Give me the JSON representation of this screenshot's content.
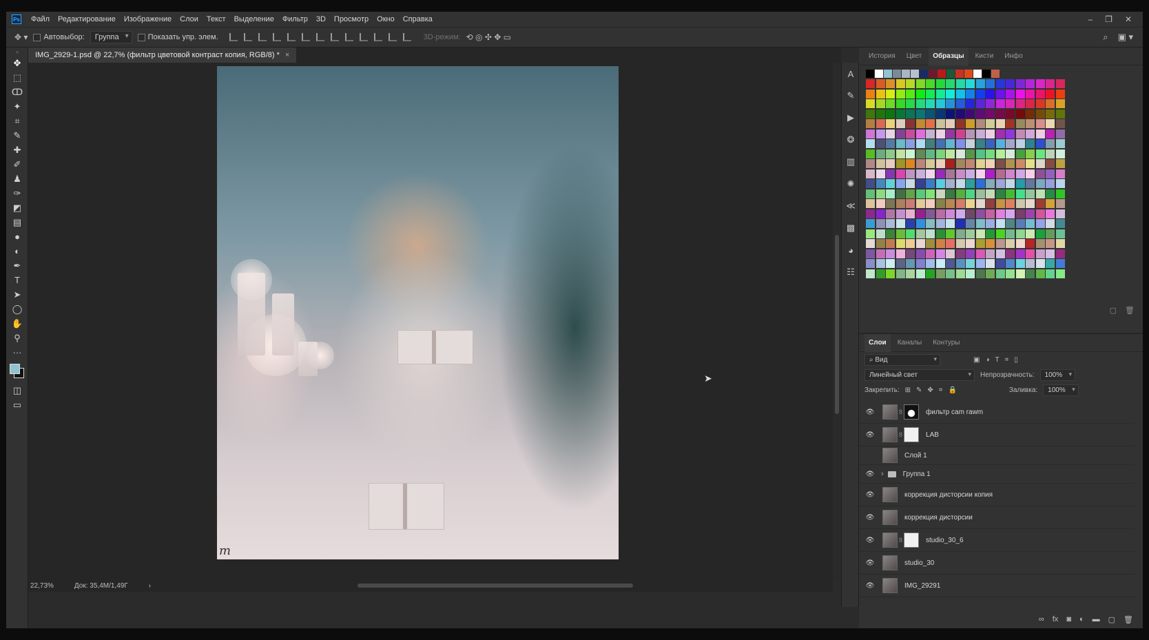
{
  "menu": [
    "Файл",
    "Редактирование",
    "Изображение",
    "Слои",
    "Текст",
    "Выделение",
    "Фильтр",
    "3D",
    "Просмотр",
    "Окно",
    "Справка"
  ],
  "app_logo": "Ps",
  "window_controls": [
    "–",
    "❐",
    "✕"
  ],
  "options": {
    "autoselect_label": "Автовыбор:",
    "autoselect_value": "Группа",
    "show_transform_label": "Показать упр. элем.",
    "mode3d_label": "3D-режим:"
  },
  "document_tab": {
    "title": "IMG_2929-1.psd @ 22,7% (фильтр цветовой контраст копия, RGB/8) *",
    "close": "×"
  },
  "status": {
    "zoom": "22,73%",
    "doc": "Док: 35,4M/1,49Г",
    "arrow": "›"
  },
  "photo_watermark": "m",
  "colors": {
    "accent": "#31a8ff",
    "foreground": "#8fc3d1",
    "background": "#111111"
  },
  "top_panel": {
    "tabs": [
      "История",
      "Цвет",
      "Образцы",
      "Кисти",
      "Инфо"
    ],
    "active_tab": "Образцы"
  },
  "recent_swatches": [
    "#000000",
    "#ffffff",
    "#8fc3d1",
    "#7a8a99",
    "#a9b6c4",
    "#b7c1cf",
    "#1a2a66",
    "#6b1a2e",
    "#b81a1a",
    "#1a5a3a",
    "#c83222",
    "#e04a1a",
    "#ffffff",
    "#000000",
    "#c0604a"
  ],
  "layers_panel": {
    "tabs": [
      "Слои",
      "Каналы",
      "Контуры"
    ],
    "active_tab": "Слои",
    "filter_label": "Вид",
    "blend_mode": "Линейный свет",
    "opacity_label": "Непрозрачность:",
    "opacity_value": "100%",
    "lock_label": "Закрепить:",
    "fill_label": "Заливка:",
    "fill_value": "100%",
    "layers": [
      {
        "name": "фильтр cam rawm",
        "visible": true,
        "mask": "dark"
      },
      {
        "name": "LAB",
        "visible": true,
        "mask": "light"
      },
      {
        "name": "Слой 1",
        "visible": false,
        "mask": "none"
      },
      {
        "name": "Группа 1",
        "visible": true,
        "mask": "group"
      },
      {
        "name": "коррекция дисторсии копия",
        "visible": true,
        "mask": "none"
      },
      {
        "name": "коррекция дисторсии",
        "visible": true,
        "mask": "none"
      },
      {
        "name": "studio_30_6",
        "visible": true,
        "mask": "light"
      },
      {
        "name": "studio_30",
        "visible": true,
        "mask": "none"
      },
      {
        "name": "IMG_29291",
        "visible": true,
        "mask": "none"
      }
    ]
  }
}
